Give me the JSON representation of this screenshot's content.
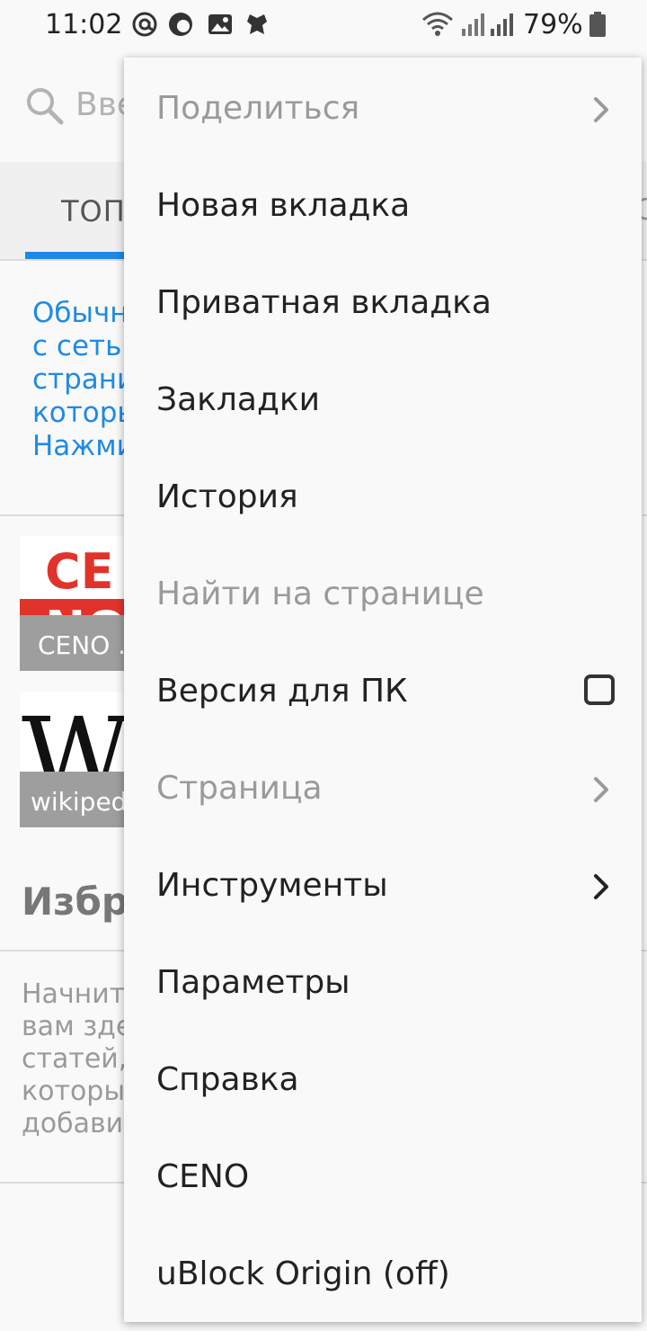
{
  "status_bar": {
    "time": "11:02",
    "battery_percent": "79%",
    "icons": [
      "at-sign-icon",
      "ceno-notification-icon",
      "image-icon",
      "app-notification-icon",
      "wifi-icon",
      "signal-icon",
      "signal-icon",
      "battery-icon"
    ]
  },
  "url_bar": {
    "placeholder": "Вве",
    "icon": "search-icon"
  },
  "tabs": {
    "active_label": "ТОП",
    "next_label_fragment": "С"
  },
  "notice": {
    "lines": [
      "Обычн",
      "с сеть",
      "страни",
      "которы",
      "Нажми"
    ]
  },
  "top_sites": [
    {
      "label": "CENO .",
      "icon": "ceno-logo"
    },
    {
      "label": "wikiped",
      "icon": "wikipedia-logo"
    }
  ],
  "favorites": {
    "title": "Избра",
    "lines": [
      "Начнит",
      "вам зде",
      "статей,",
      "которы",
      "добави"
    ]
  },
  "menu": {
    "items": [
      {
        "label": "Поделиться",
        "disabled": true,
        "trailing": "chevron-right-icon"
      },
      {
        "label": "Новая вкладка",
        "disabled": false
      },
      {
        "label": "Приватная вкладка",
        "disabled": false
      },
      {
        "label": "Закладки",
        "disabled": false
      },
      {
        "label": "История",
        "disabled": false
      },
      {
        "label": "Найти на странице",
        "disabled": true
      },
      {
        "label": "Версия для ПК",
        "disabled": false,
        "trailing": "checkbox",
        "checked": false
      },
      {
        "label": "Страница",
        "disabled": true,
        "trailing": "chevron-right-icon"
      },
      {
        "label": "Инструменты",
        "disabled": false,
        "trailing": "chevron-right-icon"
      },
      {
        "label": "Параметры",
        "disabled": false
      },
      {
        "label": "Справка",
        "disabled": false
      },
      {
        "label": "CENO",
        "disabled": false
      },
      {
        "label": "uBlock Origin (off)",
        "disabled": false
      }
    ]
  },
  "colors": {
    "accent": "#1f8ae6",
    "disabled_text": "#9a9a9a",
    "menu_bg": "#f9f9f9",
    "ceno_red": "#e2332b"
  }
}
